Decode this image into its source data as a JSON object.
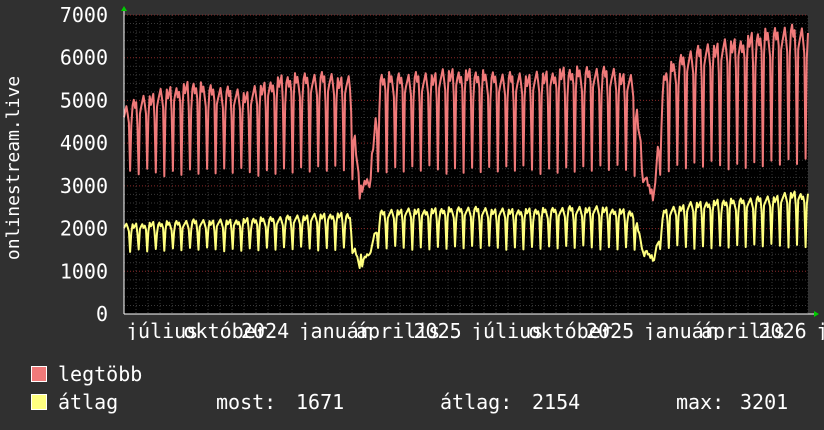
{
  "chart_data": {
    "type": "line",
    "ylabel": "onlinestream.live",
    "ylim": [
      0,
      7000
    ],
    "yticks": [
      0,
      1000,
      2000,
      3000,
      4000,
      5000,
      6000,
      7000
    ],
    "x_tick_labels": [
      "július",
      "október",
      "2024",
      "január",
      "április",
      "2025",
      "július",
      "október",
      "2025",
      "január",
      "április",
      "2026",
      "július"
    ],
    "grid": true,
    "series": [
      {
        "name": "legtöbb",
        "color": "#f07a7a",
        "anchors": [
          [
            0,
            4750
          ],
          [
            0.03,
            5000
          ],
          [
            0.07,
            5200
          ],
          [
            0.1,
            5300
          ],
          [
            0.14,
            5200
          ],
          [
            0.18,
            5100
          ],
          [
            0.22,
            5400
          ],
          [
            0.26,
            5500
          ],
          [
            0.3,
            5500
          ],
          [
            0.33,
            5400
          ],
          [
            0.335,
            4500
          ],
          [
            0.345,
            2900
          ],
          [
            0.36,
            3300
          ],
          [
            0.375,
            5500
          ],
          [
            0.4,
            5500
          ],
          [
            0.44,
            5500
          ],
          [
            0.48,
            5600
          ],
          [
            0.52,
            5550
          ],
          [
            0.56,
            5500
          ],
          [
            0.6,
            5500
          ],
          [
            0.64,
            5600
          ],
          [
            0.68,
            5650
          ],
          [
            0.72,
            5600
          ],
          [
            0.745,
            5400
          ],
          [
            0.76,
            3300
          ],
          [
            0.775,
            2800
          ],
          [
            0.79,
            5600
          ],
          [
            0.82,
            6000
          ],
          [
            0.86,
            6200
          ],
          [
            0.9,
            6300
          ],
          [
            0.94,
            6500
          ],
          [
            0.97,
            6600
          ],
          [
            1.0,
            6500
          ]
        ],
        "dip_low": 3000
      },
      {
        "name": "átlag",
        "color": "#ffff80",
        "anchors": [
          [
            0,
            2050
          ],
          [
            0.05,
            2100
          ],
          [
            0.1,
            2150
          ],
          [
            0.15,
            2150
          ],
          [
            0.2,
            2200
          ],
          [
            0.25,
            2250
          ],
          [
            0.3,
            2300
          ],
          [
            0.33,
            2300
          ],
          [
            0.335,
            1600
          ],
          [
            0.345,
            1150
          ],
          [
            0.36,
            1500
          ],
          [
            0.375,
            2350
          ],
          [
            0.4,
            2400
          ],
          [
            0.45,
            2400
          ],
          [
            0.5,
            2450
          ],
          [
            0.55,
            2400
          ],
          [
            0.6,
            2400
          ],
          [
            0.65,
            2450
          ],
          [
            0.7,
            2450
          ],
          [
            0.745,
            2350
          ],
          [
            0.76,
            1500
          ],
          [
            0.775,
            1300
          ],
          [
            0.79,
            2400
          ],
          [
            0.83,
            2550
          ],
          [
            0.87,
            2600
          ],
          [
            0.91,
            2650
          ],
          [
            0.95,
            2700
          ],
          [
            0.98,
            2800
          ],
          [
            1.0,
            2750
          ]
        ],
        "dip_low": 1400
      }
    ]
  },
  "legend": {
    "max_label": "legtöbb",
    "avg_label": "átlag",
    "now_label": "most:",
    "now_value": "1671",
    "mean_label": "átlag:",
    "mean_value": "2154",
    "peak_label": "max:",
    "peak_value": "3201"
  }
}
